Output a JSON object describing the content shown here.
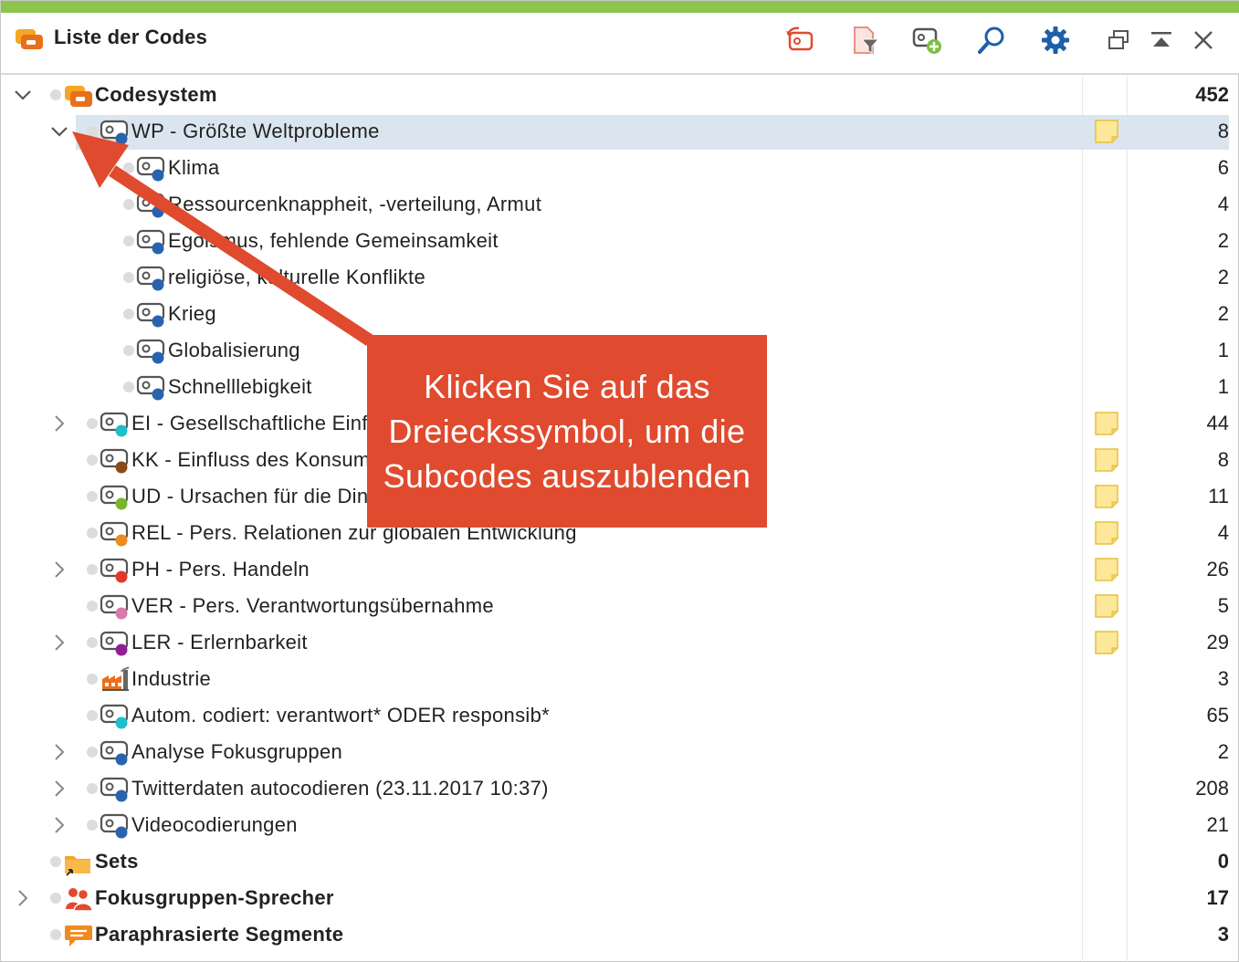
{
  "window": {
    "title": "Liste der Codes",
    "accent_color": "#8dc44b",
    "toolbar": [
      {
        "name": "undo-code-button",
        "icon": "code-undo-icon"
      },
      {
        "name": "filter-codes-button",
        "icon": "document-filter-icon"
      },
      {
        "name": "new-code-button",
        "icon": "code-add-icon"
      },
      {
        "name": "search-button",
        "icon": "search-icon"
      },
      {
        "name": "settings-button",
        "icon": "gear-icon"
      },
      {
        "name": "undock-button",
        "icon": "window-undock-icon"
      },
      {
        "name": "collapse-panel-button",
        "icon": "collapse-up-icon"
      },
      {
        "name": "close-button",
        "icon": "close-icon"
      }
    ]
  },
  "tree": {
    "rows": [
      {
        "label": "Codesystem",
        "count": "452",
        "bold": true,
        "icon": "codesystem-icon",
        "chevron": "down"
      },
      {
        "label": "WP - Größte Weltprobleme",
        "count": "8",
        "icon": "code-icon",
        "color": "#2a63ad",
        "chevron": "down",
        "memo": true,
        "selected": true
      },
      {
        "label": "Klima",
        "count": "6",
        "icon": "code-icon",
        "color": "#2a63ad"
      },
      {
        "label": "Ressourcenknappheit, -verteilung, Armut",
        "count": "4",
        "icon": "code-icon",
        "color": "#2a63ad"
      },
      {
        "label": "Egoismus, fehlende Gemeinsamkeit",
        "count": "2",
        "icon": "code-icon",
        "color": "#2a63ad"
      },
      {
        "label": "religiöse, kulturelle Konflikte",
        "count": "2",
        "icon": "code-icon",
        "color": "#2a63ad"
      },
      {
        "label": "Krieg",
        "count": "2",
        "icon": "code-icon",
        "color": "#2a63ad"
      },
      {
        "label": "Globalisierung",
        "count": "1",
        "icon": "code-icon",
        "color": "#2a63ad"
      },
      {
        "label": "Schnelllebigkeit",
        "count": "1",
        "icon": "code-icon",
        "color": "#2a63ad"
      },
      {
        "label": "EI - Gesellschaftliche Einflüsse",
        "count": "44",
        "icon": "code-icon",
        "color": "#1fbecb",
        "chevron": "right",
        "memo": true
      },
      {
        "label": "KK - Einfluss des Konsums",
        "count": "8",
        "icon": "code-icon",
        "color": "#8a4b17",
        "memo": true
      },
      {
        "label": "UD - Ursachen für die Dinge",
        "count": "11",
        "icon": "code-icon",
        "color": "#7bb52e",
        "memo": true
      },
      {
        "label": "REL - Pers. Relationen zur globalen Entwicklung",
        "count": "4",
        "icon": "code-icon",
        "color": "#f08a1c",
        "memo": true
      },
      {
        "label": "PH - Pers. Handeln",
        "count": "26",
        "icon": "code-icon",
        "color": "#e0382a",
        "chevron": "right",
        "memo": true
      },
      {
        "label": "VER - Pers. Verantwortungsübernahme",
        "count": "5",
        "icon": "code-icon",
        "color": "#d97aa8",
        "memo": true
      },
      {
        "label": "LER - Erlernbarkeit",
        "count": "29",
        "icon": "code-icon",
        "color": "#8f1f96",
        "chevron": "right",
        "memo": true
      },
      {
        "label": "Industrie",
        "count": "3",
        "icon": "factory-icon"
      },
      {
        "label": "Autom. codiert: verantwort* ODER responsib*",
        "count": "65",
        "icon": "code-icon",
        "color": "#1fbecb"
      },
      {
        "label": "Analyse Fokusgruppen",
        "count": "2",
        "icon": "code-icon",
        "color": "#2a63ad",
        "chevron": "right"
      },
      {
        "label": "Twitterdaten autocodieren (23.11.2017 10:37)",
        "count": "208",
        "icon": "code-icon",
        "color": "#2a63ad",
        "chevron": "right"
      },
      {
        "label": "Videocodierungen",
        "count": "21",
        "icon": "code-icon",
        "color": "#2a63ad",
        "chevron": "right"
      },
      {
        "label": "Sets",
        "count": "0",
        "bold": true,
        "icon": "sets-folder-icon"
      },
      {
        "label": "Fokusgruppen-Sprecher",
        "count": "17",
        "bold": true,
        "icon": "speakers-icon",
        "chevron": "right"
      },
      {
        "label": "Paraphrasierte Segmente",
        "count": "3",
        "bold": true,
        "icon": "paraphrase-icon"
      }
    ]
  },
  "callout": {
    "line1": "Klicken Sie auf das",
    "line2": "Dreieckssymbol, um die",
    "line3": "Subcodes auszublenden",
    "color": "#e04a2e"
  }
}
